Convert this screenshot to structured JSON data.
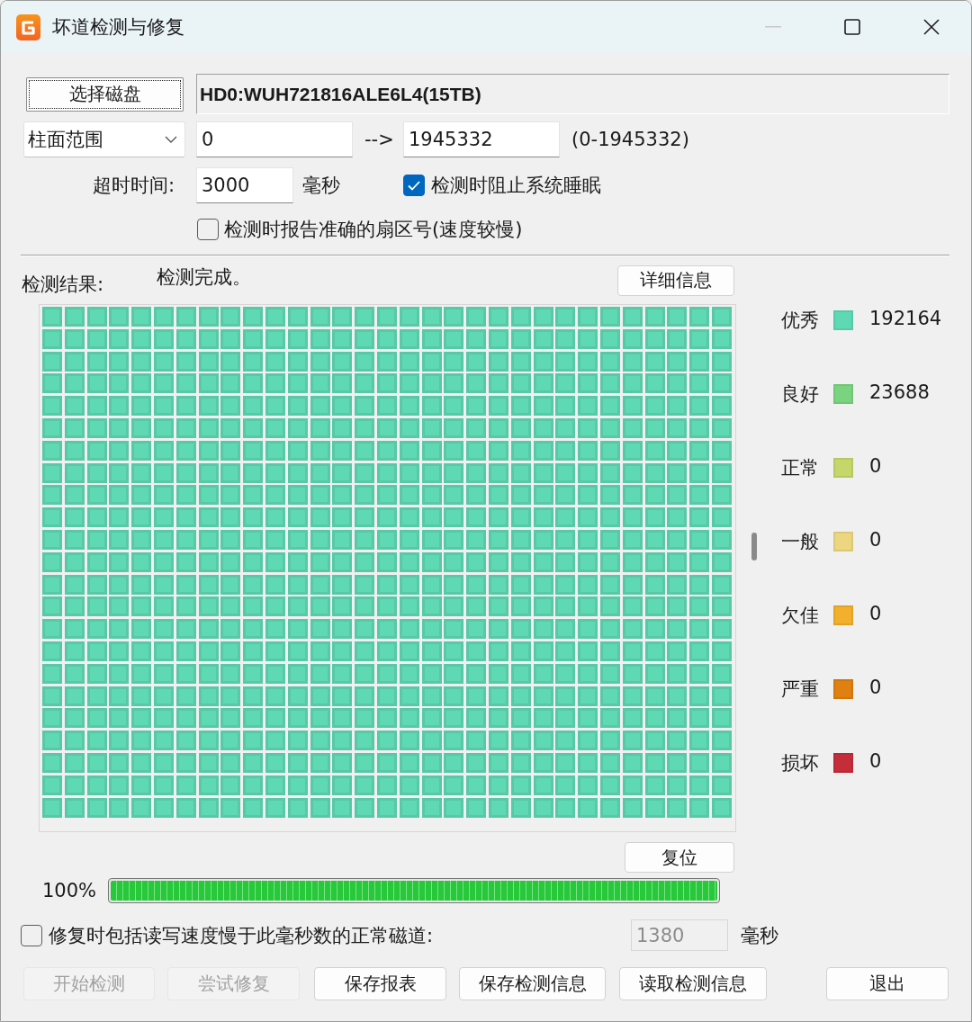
{
  "window": {
    "title": "坏道检测与修复",
    "buttons": [
      {
        "kind": "minimize",
        "disabled": true
      },
      {
        "kind": "maximize",
        "disabled": false
      },
      {
        "kind": "close",
        "disabled": false
      }
    ]
  },
  "disk": {
    "button": "选择磁盘",
    "focused": true,
    "name": "HD0:WUH721816ALE6L4(15TB)"
  },
  "range": {
    "mode": "柱面范围",
    "start": "0",
    "arrow": "-->",
    "end": "1945332",
    "bounds": "(0-1945332)"
  },
  "timeout": {
    "label": "超时时间:",
    "value": "3000",
    "unit": "毫秒"
  },
  "options": [
    {
      "label": "检测时阻止系统睡眠",
      "checked": true
    },
    {
      "label": "检测时报告准确的扇区号(速度较慢)",
      "checked": false
    }
  ],
  "result": {
    "label": "检测结果:",
    "status": "检测完成。",
    "details_button": "详细信息"
  },
  "legend": [
    {
      "label": "优秀",
      "color": "#5fd8b4",
      "count": "192164"
    },
    {
      "label": "良好",
      "color": "#7ad47f",
      "count": "23688"
    },
    {
      "label": "正常",
      "color": "#c5d76b",
      "count": "0"
    },
    {
      "label": "一般",
      "color": "#ecd780",
      "count": "0"
    },
    {
      "label": "欠佳",
      "color": "#f2b02c",
      "count": "0"
    },
    {
      "label": "严重",
      "color": "#df8010",
      "count": "0"
    },
    {
      "label": "损坏",
      "color": "#c52d3b",
      "count": "0"
    }
  ],
  "reset_button": "复位",
  "progress": {
    "reading": "100%",
    "level": 1
  },
  "repair": {
    "label": "修复时包括读写速度慢于此毫秒数的正常磁道:",
    "checked": false,
    "value": "1380",
    "disabled": true,
    "unit": "毫秒"
  },
  "buttons": [
    {
      "label": "开始检测",
      "disabled": true
    },
    {
      "label": "尝试修复",
      "disabled": true
    },
    {
      "label": "保存报表",
      "disabled": false
    },
    {
      "label": "保存检测信息",
      "disabled": false
    },
    {
      "label": "读取检测信息",
      "disabled": false
    },
    {
      "label": "退出",
      "disabled": false
    }
  ]
}
